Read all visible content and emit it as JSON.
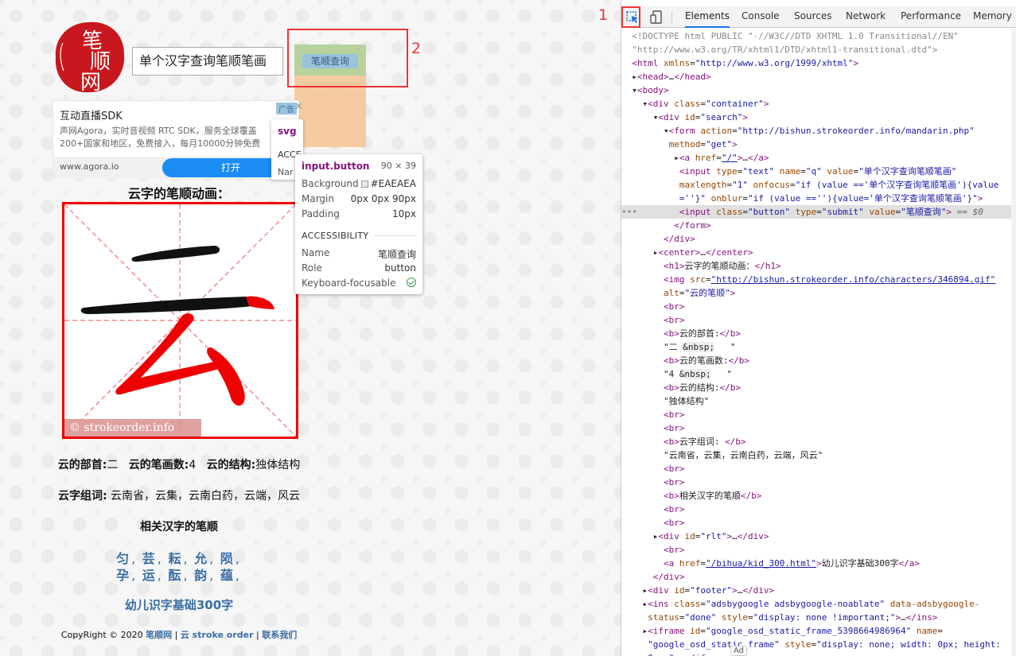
{
  "left": {
    "logo_text": [
      "笔",
      "顺",
      "网"
    ],
    "search_value": "单个汉字查询笔顺笔画",
    "search_button": "笔顺查询",
    "annotations": {
      "one": "1",
      "two": "2"
    },
    "ad": {
      "title": "互动直播SDK",
      "badge": "广告",
      "close": "✕",
      "desc": "声网Agora，实时音视频 RTC SDK，服务全球覆盖200+国家和地区，免费接入，每月10000分钟免费",
      "site": "www.agora.io",
      "open": "打开"
    },
    "h1": "云字的笔顺动画：",
    "character": "云",
    "watermark": "© strokeorder.info",
    "info": {
      "radical_label": "云的部首:",
      "radical_value": "二",
      "strokes_label": "云的笔画数:",
      "strokes_value": "4",
      "structure_label": "云的结构:",
      "structure_value": "独体结构"
    },
    "words": {
      "label": "云字组词:",
      "value": "云南省，云集，云南白药，云端，风云"
    },
    "related_title": "相关汉字的笔顺",
    "related_row1": [
      "匀",
      "芸",
      "耘",
      "允",
      "陨"
    ],
    "related_row2": [
      "孕",
      "运",
      "酝",
      "韵",
      "蕴"
    ],
    "kid_link": "幼儿识字基础300字",
    "footer": {
      "prefix": "CopyRight © 2020 ",
      "l1": "笔顺网",
      "sep1": " | ",
      "l2": "云 stroke order",
      "sep2": " | ",
      "l3": "联系我们"
    }
  },
  "tooltip_svg": {
    "tag": "svg",
    "acc": "ACCE",
    "name": "Nar"
  },
  "tooltip": {
    "name": "input.button",
    "size": "90 × 39",
    "rows": [
      {
        "k": "Background",
        "v": "#EAEAEA"
      },
      {
        "k": "Margin",
        "v": "0px 0px 90px"
      },
      {
        "k": "Padding",
        "v": "10px"
      }
    ],
    "section": "ACCESSIBILITY",
    "acc_rows": [
      {
        "k": "Name",
        "v": "笔顺查询"
      },
      {
        "k": "Role",
        "v": "button"
      },
      {
        "k": "Keyboard-focusable",
        "v": ""
      }
    ]
  },
  "devtools": {
    "tabs": [
      "Elements",
      "Console",
      "Sources",
      "Network",
      "Performance",
      "Memory"
    ],
    "active_tab": "Elements",
    "ad_chip": "Ad"
  },
  "colors": {
    "highlight_content": "#b7d29d",
    "highlight_margin": "#f5c89c",
    "annotation": "#e33333",
    "link": "#3a6ea5"
  }
}
